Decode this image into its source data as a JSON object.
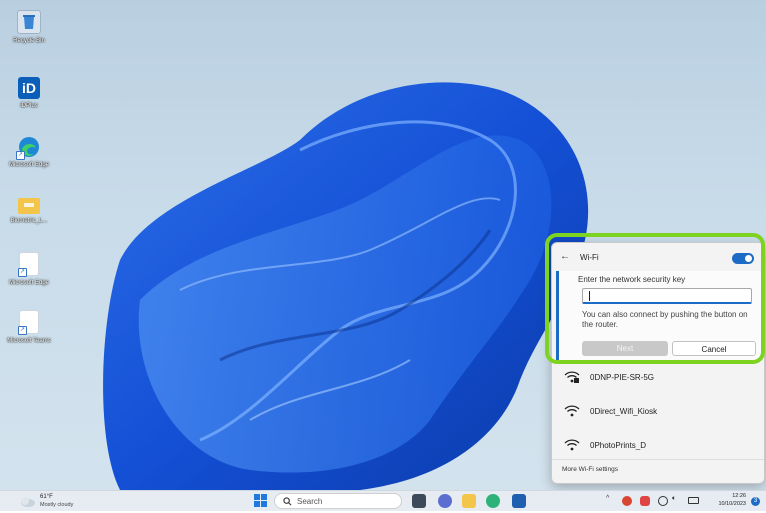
{
  "desktop": {
    "icons": [
      {
        "label": "Recycle Bin",
        "icon": "recycle-bin-icon"
      },
      {
        "label": "iDPlus",
        "icon": "idplus-icon"
      },
      {
        "label": "Microsoft Edge",
        "icon": "edge-icon"
      },
      {
        "label": "Biometric_L...",
        "icon": "folder-icon"
      },
      {
        "label": "Microsoft Edge",
        "icon": "file-shortcut-icon"
      },
      {
        "label": "Microsoft Teams",
        "icon": "file-shortcut-icon"
      }
    ]
  },
  "wifi_panel": {
    "title": "Wi-Fi",
    "toggle_on": true,
    "security_label": "Enter the network security key",
    "input_value": "",
    "hint": "You can also connect by pushing the button on the router.",
    "next_label": "Next",
    "cancel_label": "Cancel",
    "networks": [
      {
        "name": "0DNP-PIE-SR-5G",
        "secured": true
      },
      {
        "name": "0Direct_Wifi_Kiosk",
        "secured": false
      },
      {
        "name": "0PhotoPrints_D",
        "secured": false
      }
    ],
    "more_settings": "More Wi-Fi settings",
    "highlight_color": "#7ed321",
    "accent_color": "#1c6bc5"
  },
  "taskbar": {
    "weather_temp": "61°F",
    "weather_condition": "Mostly cloudy",
    "search_placeholder": "Search",
    "tray_chevron": "^",
    "clock_time": "12:26",
    "clock_date": "10/10/2023",
    "notification_count": "3"
  }
}
